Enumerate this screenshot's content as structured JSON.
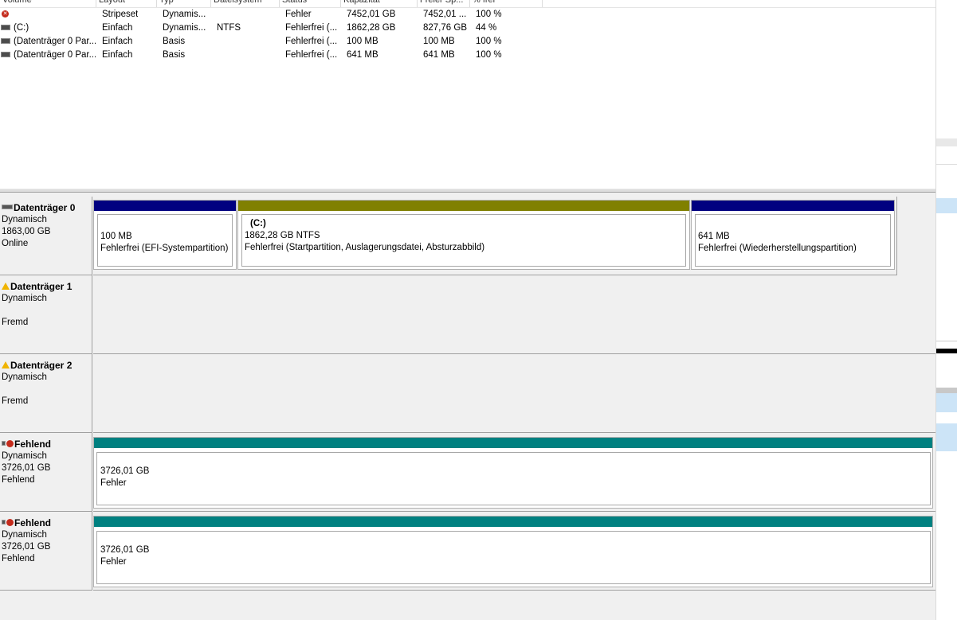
{
  "colors": {
    "basic": "#000080",
    "simple_volume": "#808000",
    "stripe": "#008080",
    "error": "#c42b1c"
  },
  "columns": [
    "Volume",
    "Layout",
    "Typ",
    "Dateisystem",
    "Status",
    "Kapazität",
    "Freier Sp...",
    "% frei"
  ],
  "volumes": [
    {
      "icon": "error-icon",
      "name": "",
      "layout": "Stripeset",
      "type": "Dynamis...",
      "fs": "",
      "status": "Fehler",
      "capacity": "7452,01 GB",
      "free": "7452,01 ...",
      "pct": "100 %"
    },
    {
      "icon": "drive-icon",
      "name": "(C:)",
      "layout": "Einfach",
      "type": "Dynamis...",
      "fs": "NTFS",
      "status": "Fehlerfrei (...",
      "capacity": "1862,28 GB",
      "free": "827,76 GB",
      "pct": "44 %"
    },
    {
      "icon": "drive-icon",
      "name": "(Datenträger 0 Par...",
      "layout": "Einfach",
      "type": "Basis",
      "fs": "",
      "status": "Fehlerfrei (...",
      "capacity": "100 MB",
      "free": "100 MB",
      "pct": "100 %"
    },
    {
      "icon": "drive-icon",
      "name": "(Datenträger 0 Par...",
      "layout": "Einfach",
      "type": "Basis",
      "fs": "",
      "status": "Fehlerfrei (...",
      "capacity": "641 MB",
      "free": "641 MB",
      "pct": "100 %"
    }
  ],
  "disks": [
    {
      "name": "Datenträger 0",
      "icon": "disk-icon",
      "type": "Dynamisch",
      "size": "1863,00 GB",
      "status": "Online",
      "partitions": [
        {
          "name": "",
          "size": "100 MB",
          "status": "Fehlerfrei (EFI-Systempartition)"
        },
        {
          "name": "(C:)",
          "size": "1862,28 GB NTFS",
          "status": "Fehlerfrei (Startpartition, Auslagerungsdatei, Absturzabbild)"
        },
        {
          "name": "",
          "size": "641 MB",
          "status": "Fehlerfrei (Wiederherstellungspartition)"
        }
      ]
    },
    {
      "name": "Datenträger 1",
      "icon": "warning-icon",
      "type": "Dynamisch",
      "size": "",
      "status": "Fremd"
    },
    {
      "name": "Datenträger 2",
      "icon": "warning-icon",
      "type": "Dynamisch",
      "size": "",
      "status": "Fremd"
    },
    {
      "name": "Fehlend",
      "icon": "error-icon",
      "type": "Dynamisch",
      "size": "3726,01 GB",
      "status": "Fehlend",
      "partition": {
        "size": "3726,01 GB",
        "status": "Fehler"
      }
    },
    {
      "name": "Fehlend",
      "icon": "error-icon",
      "type": "Dynamisch",
      "size": "3726,01 GB",
      "status": "Fehlend",
      "partition": {
        "size": "3726,01 GB",
        "status": "Fehler"
      }
    }
  ]
}
